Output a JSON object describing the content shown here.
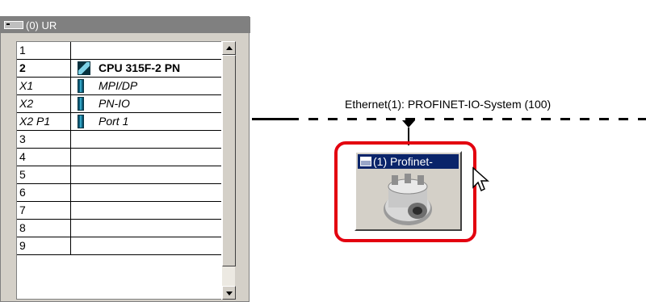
{
  "rack": {
    "title": "(0) UR",
    "rows": [
      {
        "slot": "1",
        "module": ""
      },
      {
        "slot": "2",
        "module": "CPU 315F-2 PN"
      },
      {
        "slot": "X1",
        "module": "MPI/DP"
      },
      {
        "slot": "X2",
        "module": "PN-IO"
      },
      {
        "slot": "X2 P1",
        "module": "Port 1"
      },
      {
        "slot": "3",
        "module": ""
      },
      {
        "slot": "4",
        "module": ""
      },
      {
        "slot": "5",
        "module": ""
      },
      {
        "slot": "6",
        "module": ""
      },
      {
        "slot": "7",
        "module": ""
      },
      {
        "slot": "8",
        "module": ""
      },
      {
        "slot": "9",
        "module": ""
      }
    ]
  },
  "network": {
    "label": "Ethernet(1): PROFINET-IO-System (100)"
  },
  "device": {
    "title": "(1) Profinet-",
    "image_icon": "rotary-encoder-icon",
    "highlight_color": "#e3000f"
  },
  "colors": {
    "selection_blue": "#0a246a",
    "window_gray": "#d4d0c8",
    "module_teal": "#35a6c6"
  }
}
